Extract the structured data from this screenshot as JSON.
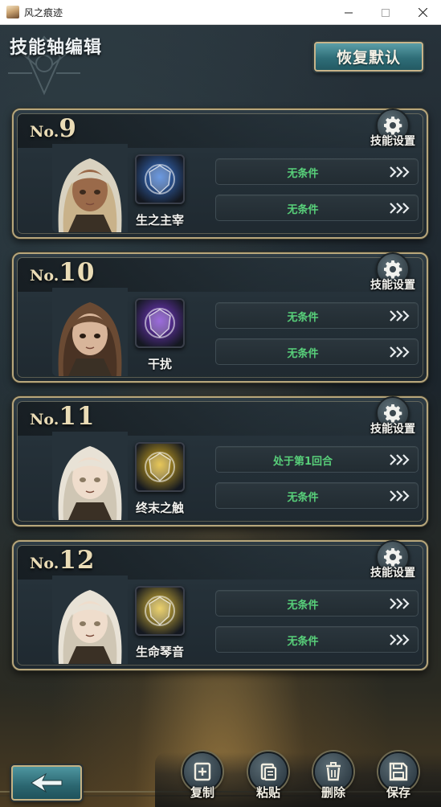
{
  "window": {
    "title": "风之痕迹",
    "icons": {
      "app": "app-icon",
      "minimize": "minimize-icon",
      "maximize": "maximize-icon",
      "close": "close-icon"
    }
  },
  "header": {
    "title": "技能轴编辑",
    "restore_label": "恢复默认"
  },
  "cards": [
    {
      "prefix": "No.",
      "number": "9",
      "settings_label": "技能设置",
      "skill_name": "生之主宰",
      "skill_icon": "shield-icon",
      "skill_color": "#3a78d8",
      "conditions": [
        "无条件",
        "无条件"
      ]
    },
    {
      "prefix": "No.",
      "number": "10",
      "settings_label": "技能设置",
      "skill_name": "干扰",
      "skill_icon": "purple-spirit-icon",
      "skill_color": "#7b3ad1",
      "conditions": [
        "无条件",
        "无条件"
      ]
    },
    {
      "prefix": "No.",
      "number": "11",
      "settings_label": "技能设置",
      "skill_name": "终末之触",
      "skill_icon": "golden-warrior-icon",
      "skill_color": "#e0b420",
      "conditions": [
        "处于第1回合",
        "无条件"
      ]
    },
    {
      "prefix": "No.",
      "number": "12",
      "settings_label": "技能设置",
      "skill_name": "生命琴音",
      "skill_icon": "golden-warrior-icon",
      "skill_color": "#e6c23a",
      "conditions": [
        "无条件",
        "无条件"
      ]
    }
  ],
  "condition_color": "#58d07a",
  "toolbar": {
    "copy_label": "复制",
    "paste_label": "粘贴",
    "delete_label": "删除",
    "save_label": "保存"
  }
}
